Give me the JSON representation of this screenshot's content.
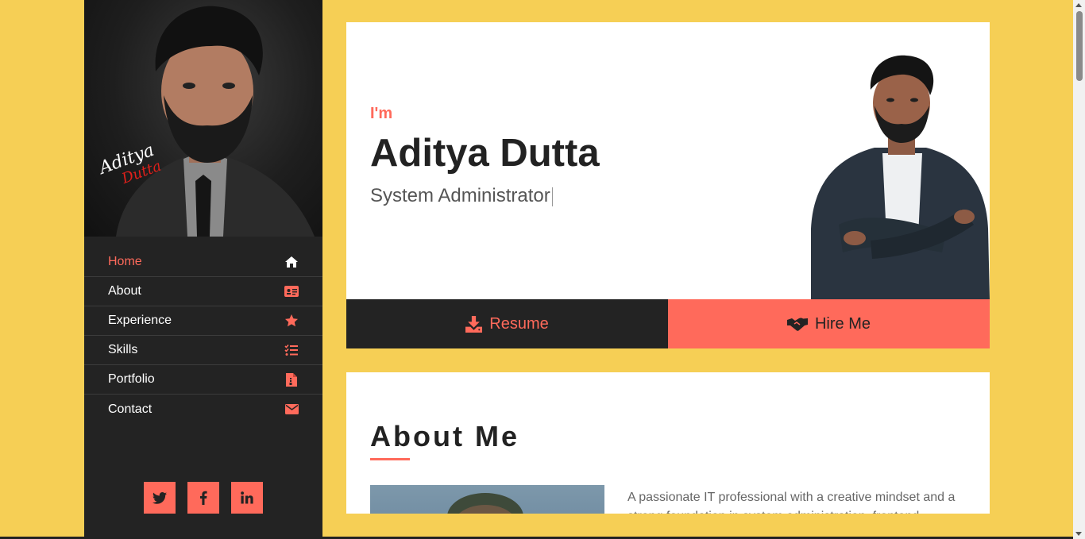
{
  "colors": {
    "page_background": "#f6cf55",
    "sidebar": "#232323",
    "accent": "#ff6a5b",
    "card": "#ffffff",
    "text_dark": "#222222"
  },
  "sidebar": {
    "signature": "Aditya Dutta",
    "nav": [
      {
        "label": "Home",
        "icon": "home-icon",
        "active": true
      },
      {
        "label": "About",
        "icon": "id-card-icon",
        "active": false
      },
      {
        "label": "Experience",
        "icon": "star-icon",
        "active": false
      },
      {
        "label": "Skills",
        "icon": "task-list-icon",
        "active": false
      },
      {
        "label": "Portfolio",
        "icon": "file-zip-icon",
        "active": false
      },
      {
        "label": "Contact",
        "icon": "envelope-icon",
        "active": false
      }
    ],
    "social": [
      {
        "icon": "twitter-icon"
      },
      {
        "icon": "facebook-icon"
      },
      {
        "icon": "linkedin-icon"
      }
    ]
  },
  "hero": {
    "greeting": "I'm",
    "name": "Aditya Dutta",
    "role": "System Administrator",
    "resume_label": "Resume",
    "resume_icon": "download-icon",
    "hire_label": "Hire Me",
    "hire_icon": "handshake-icon"
  },
  "about": {
    "title": "About Me",
    "text": "A passionate IT professional with a creative mindset and a strong foundation in system administration, frontend"
  }
}
